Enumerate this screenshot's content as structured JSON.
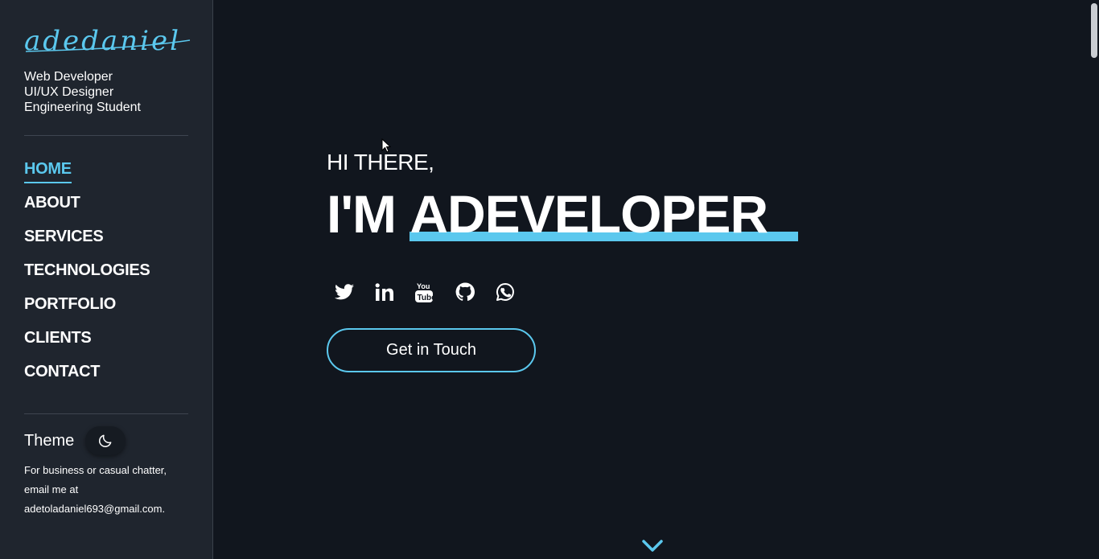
{
  "sidebar": {
    "logo": "adedaniel",
    "roles": [
      "Web Developer",
      "UI/UX Designer",
      "Engineering Student"
    ],
    "nav": [
      "HOME",
      "ABOUT",
      "SERVICES",
      "TECHNOLOGIES",
      "PORTFOLIO",
      "CLIENTS",
      "CONTACT"
    ],
    "active_nav": "HOME",
    "theme_label": "Theme",
    "theme_icon": "moon-icon",
    "contact_text": "For business or casual chatter, email me at adetoladaniel693@gmail.com."
  },
  "hero": {
    "greeting": "HI THERE,",
    "headline_prefix": "I'M ",
    "headline_highlight": "ADEVELOPER",
    "socials": [
      "twitter-icon",
      "linkedin-icon",
      "youtube-icon",
      "github-icon",
      "whatsapp-icon"
    ],
    "cta_label": "Get in Touch",
    "scroll_icon": "chevron-down-icon"
  },
  "colors": {
    "accent": "#5bc8ee",
    "background": "#11161e",
    "sidebar_background": "#1f252e",
    "text": "#ffffff"
  }
}
